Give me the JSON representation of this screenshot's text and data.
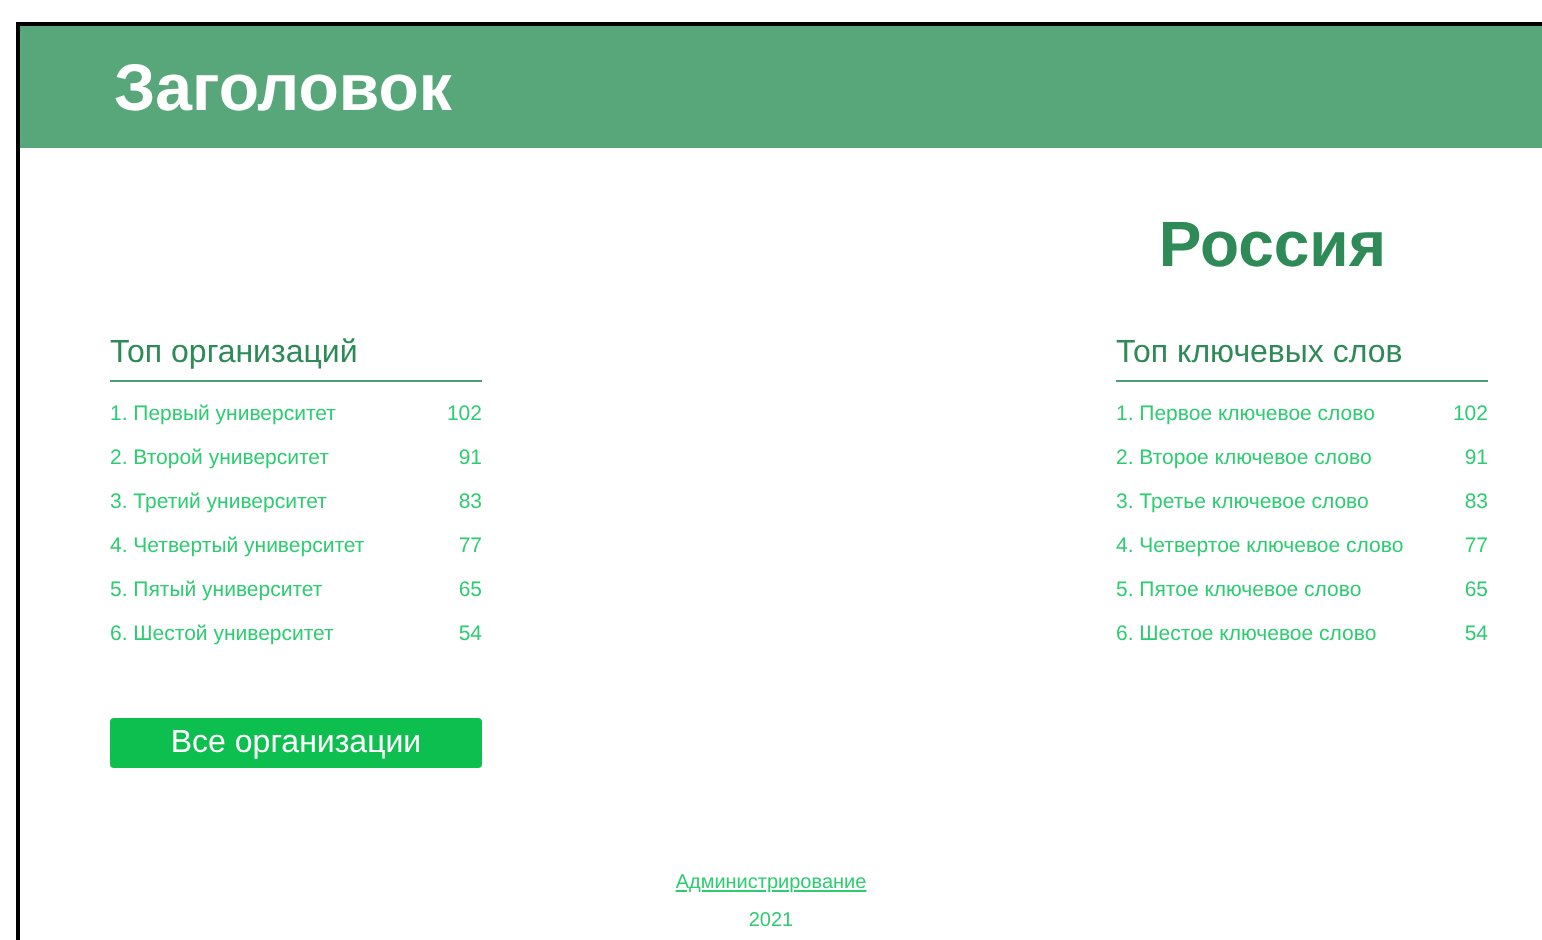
{
  "header": {
    "title": "Заголовок"
  },
  "region": "Россия",
  "organizations": {
    "title": "Топ организаций",
    "items": [
      {
        "name": "1. Первый университет",
        "count": "102"
      },
      {
        "name": "2. Второй университет",
        "count": "91"
      },
      {
        "name": "3. Третий университет",
        "count": "83"
      },
      {
        "name": "4. Четвертый университет",
        "count": "77"
      },
      {
        "name": "5. Пятый университет",
        "count": "65"
      },
      {
        "name": "6. Шестой университет",
        "count": "54"
      }
    ],
    "button": "Все организации"
  },
  "keywords": {
    "title": "Топ ключевых слов",
    "items": [
      {
        "name": "1. Первое ключевое слово",
        "count": "102"
      },
      {
        "name": "2. Второе ключевое слово",
        "count": "91"
      },
      {
        "name": "3. Третье ключевое слово",
        "count": "83"
      },
      {
        "name": "4. Четвертое ключевое слово",
        "count": "77"
      },
      {
        "name": "5. Пятое ключевое слово",
        "count": "65"
      },
      {
        "name": "6. Шестое ключевое слово",
        "count": "54"
      }
    ]
  },
  "footer": {
    "link": "Администрирование",
    "year": "2021"
  }
}
